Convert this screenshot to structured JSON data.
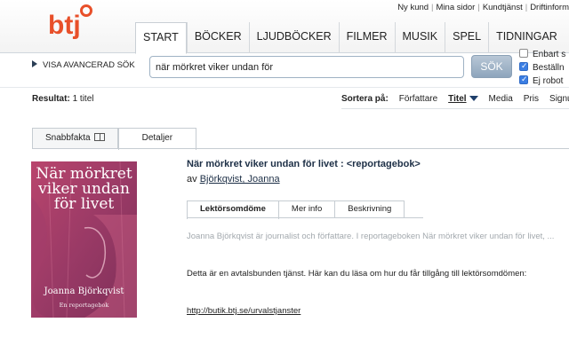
{
  "header": {
    "logo_text": "btj",
    "top_links": [
      "Ny kund",
      "Mina sidor",
      "Kundtjänst",
      "Driftinform"
    ],
    "nav_tabs": [
      {
        "label": "START",
        "active": true
      },
      {
        "label": "BÖCKER",
        "active": false
      },
      {
        "label": "LJUDBÖCKER",
        "active": false
      },
      {
        "label": "FILMER",
        "active": false
      },
      {
        "label": "MUSIK",
        "active": false
      },
      {
        "label": "SPEL",
        "active": false
      },
      {
        "label": "TIDNINGAR",
        "active": false
      }
    ]
  },
  "search": {
    "advanced_label": "VISA AVANCERAD SÖK",
    "query": "när mörkret viker undan för",
    "button_label": "SÖK",
    "options": [
      {
        "label": "Enbart s",
        "checked": false
      },
      {
        "label": "Beställn",
        "checked": true
      },
      {
        "label": "Ej robot",
        "checked": true
      }
    ]
  },
  "results": {
    "label": "Resultat:",
    "count": "1 titel"
  },
  "sort": {
    "label": "Sortera på:",
    "options": [
      "Författare",
      "Titel",
      "Media",
      "Pris",
      "Signu"
    ],
    "current": "Titel"
  },
  "view_tabs": [
    {
      "label": "Snabbfakta",
      "active": false
    },
    {
      "label": "Detaljer",
      "active": true
    }
  ],
  "book": {
    "cover": {
      "title": "När mörkret viker undan för livet",
      "author": "Joanna Björkqvist",
      "subtitle": "En reportagebok"
    },
    "title": "När mörkret viker undan för livet : <reportagebok>",
    "author_prefix": "av",
    "author": "Björkqvist, Joanna",
    "detail_tabs": [
      {
        "label": "Lektörsomdöme",
        "active": true
      },
      {
        "label": "Mer info",
        "active": false
      },
      {
        "label": "Beskrivning",
        "active": false
      }
    ],
    "excerpt": "Joanna Björkqvist är journalist och författare. I reportageboken När mörkret viker undan för livet, ...",
    "notice": "Detta är en avtalsbunden tjänst. Här kan du läsa om hur du får tillgång till lektörsomdömen:",
    "link": "http://butik.btj.se/urvalstjanster"
  },
  "colors": {
    "brand_orange": "#e8502a",
    "accent_navy": "#1d2f46",
    "search_button": "#9cb1c6",
    "checkbox_on": "#3b7ee3"
  }
}
